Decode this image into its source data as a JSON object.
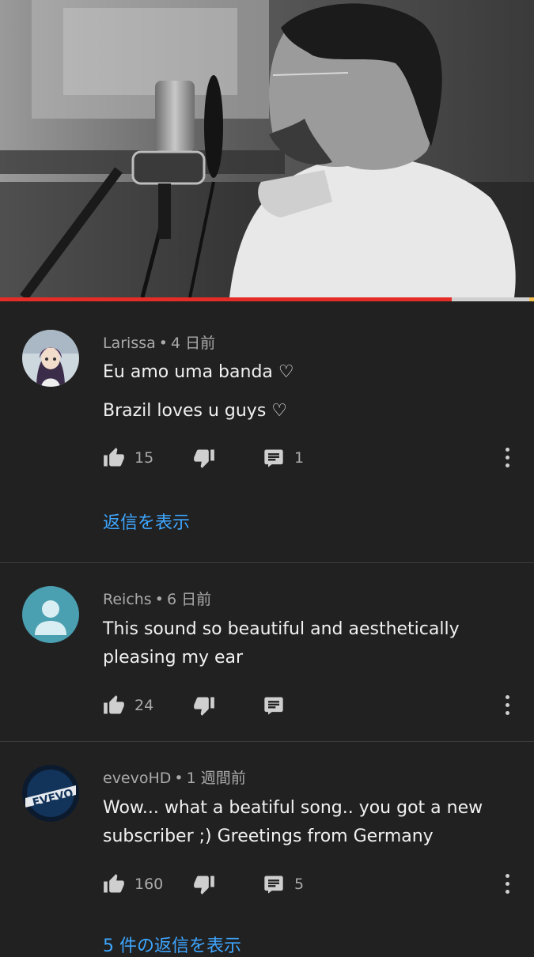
{
  "video": {
    "progress": 0.846
  },
  "comments": [
    {
      "author": "Larissa",
      "dot": "•",
      "time": "4 日前",
      "lines": [
        "Eu amo uma banda ♡",
        "Brazil loves u guys ♡"
      ],
      "likes": "15",
      "replies_count": "1",
      "view_replies": "返信を表示",
      "avatar": "anime-character-avatar"
    },
    {
      "author": "Reichs",
      "dot": "•",
      "time": "6 日前",
      "lines": [
        "This sound so beautiful and aesthetically pleasing my ear"
      ],
      "likes": "24",
      "replies_count": "",
      "avatar": "default-person-avatar"
    },
    {
      "author": "evevoHD",
      "dot": "•",
      "time": "1 週間前",
      "lines": [
        "Wow... what a beatiful song.. you got a new subscriber ;) Greetings from Germany"
      ],
      "likes": "160",
      "replies_count": "5",
      "view_replies": "5 件の返信を表示",
      "avatar": "evevo-logo-avatar"
    }
  ],
  "colors": {
    "background": "#212121",
    "link": "#3ea6ff",
    "progress": "#e52d27",
    "secondary_text": "#aaaaaa"
  },
  "icons": [
    "thumbs-up-icon",
    "thumbs-down-icon",
    "reply-comment-icon",
    "more-vertical-icon"
  ]
}
